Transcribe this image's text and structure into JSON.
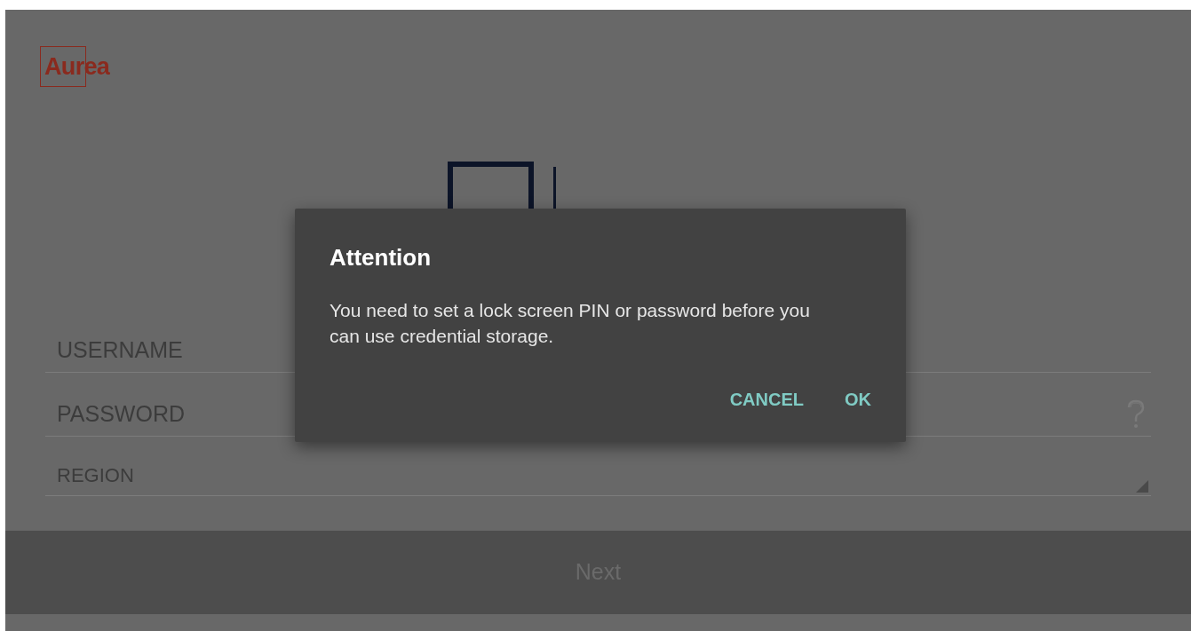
{
  "brand_logo": {
    "text": "Aurea"
  },
  "form": {
    "fields": [
      {
        "kind": "text",
        "placeholder": "USERNAME"
      },
      {
        "kind": "password",
        "placeholder": "PASSWORD"
      },
      {
        "kind": "select",
        "placeholder": "REGION"
      }
    ]
  },
  "next_button": {
    "label": "Next",
    "disabled": true
  },
  "dialog": {
    "title": "Attention",
    "message": "You need to set a lock screen PIN or password before you can use credential storage.",
    "buttons": [
      "CANCEL",
      "OK"
    ]
  }
}
